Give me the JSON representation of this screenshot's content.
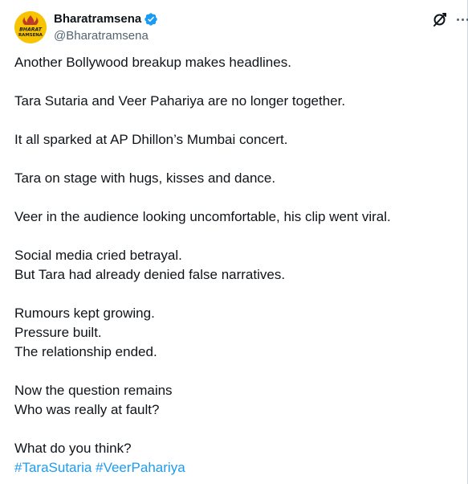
{
  "account": {
    "display_name": "Bharatramsena",
    "handle": "@Bharatramsena",
    "avatar_text_top": "BHARAT",
    "avatar_text_bottom": "RAMSENA",
    "avatar_color": "#f6c400",
    "verified_color": "#1d9bf0"
  },
  "icons": {
    "grok": "grok-icon",
    "more": "more-icon",
    "verified": "verified-badge-icon"
  },
  "tweet": {
    "para1": [
      "Another Bollywood breakup makes headlines."
    ],
    "para2": [
      "Tara Sutaria and Veer Pahariya are no longer together."
    ],
    "para3": [
      "It all sparked at AP Dhillon’s Mumbai concert."
    ],
    "para4": [
      "Tara on stage with hugs, kisses and dance."
    ],
    "para5": [
      "Veer in the audience looking uncomfortable, his clip went viral."
    ],
    "para6": [
      "Social media cried betrayal.",
      "But Tara had already denied false narratives."
    ],
    "para7": [
      "Rumours kept growing.",
      "Pressure built.",
      "The relationship ended."
    ],
    "para8": [
      "Now the question remains",
      "Who was really at fault?"
    ],
    "para9": [
      "What do you think?"
    ],
    "hashtags": [
      "#TaraSutaria",
      "#VeerPahariya"
    ]
  },
  "colors": {
    "text": "#0f1419",
    "secondary": "#536471",
    "link": "#1d9bf0"
  }
}
